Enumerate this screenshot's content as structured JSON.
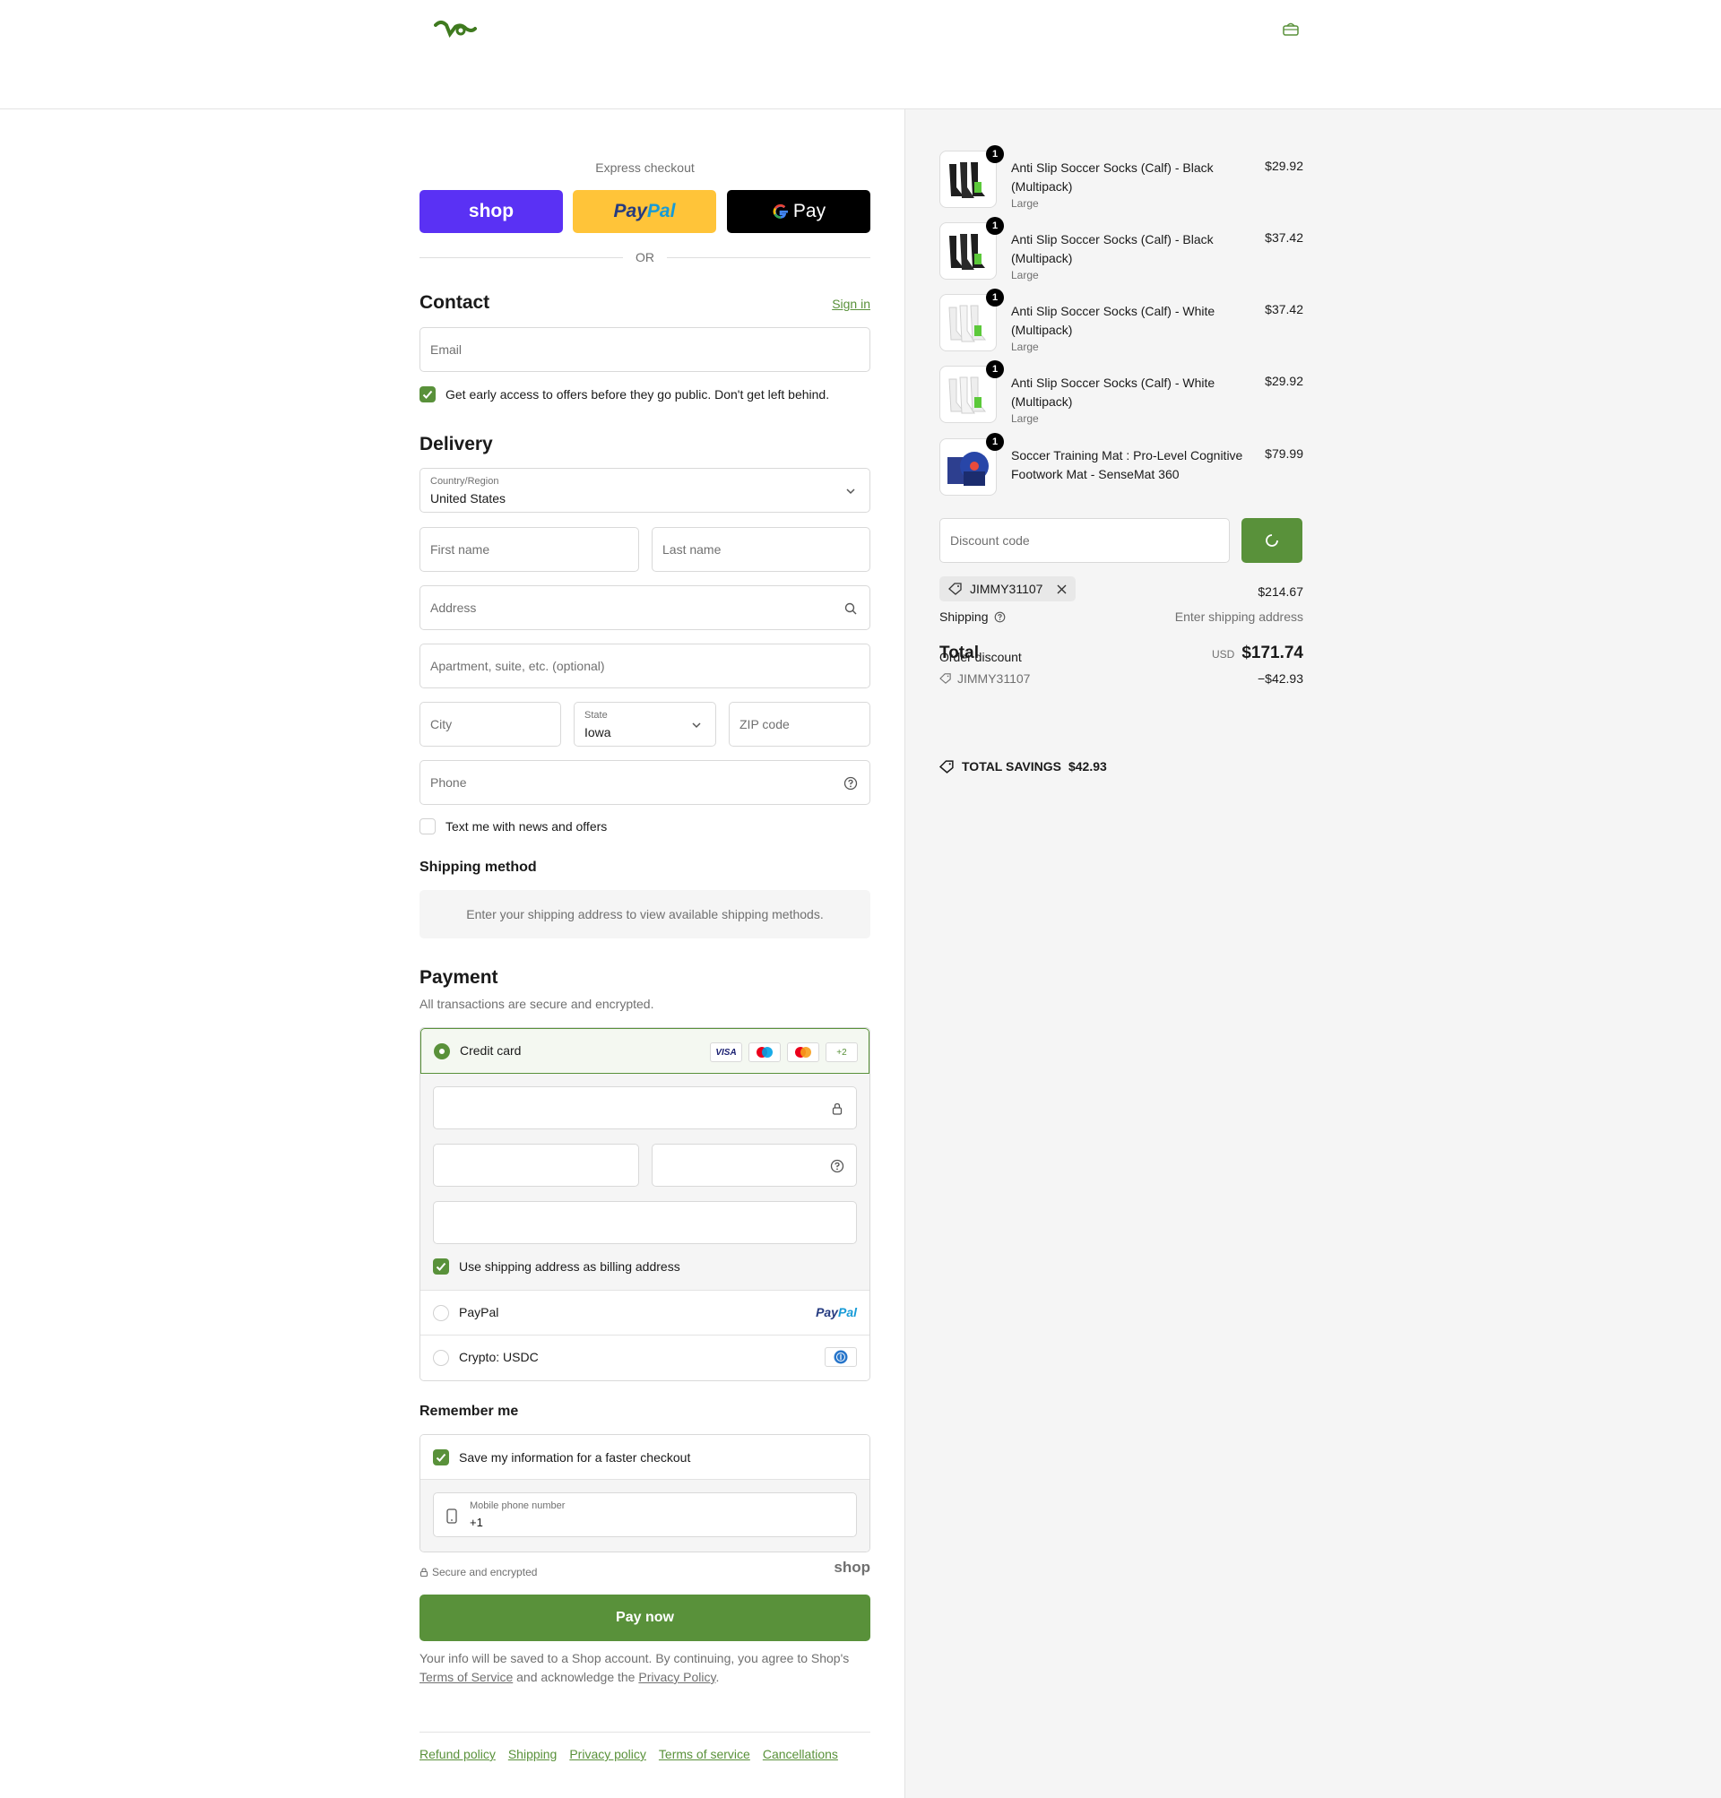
{
  "colors": {
    "accent": "#59913a",
    "shop": "#5a31f4",
    "paypal": "#ffc439",
    "gpay": "#000000"
  },
  "header": {
    "logo_icon": "brand-logo",
    "cart_icon": "bag-icon"
  },
  "express": {
    "title": "Express checkout",
    "shop_label": "shop",
    "paypal_label_1": "Pay",
    "paypal_label_2": "Pal",
    "gpay_label": "Pay",
    "or_label": "OR"
  },
  "contact": {
    "title": "Contact",
    "sign_in": "Sign in",
    "email_placeholder": "Email",
    "offers_label": "Get early access to offers before they go public. Don't get left behind."
  },
  "delivery": {
    "title": "Delivery",
    "country_label": "Country/Region",
    "country_value": "United States",
    "first_name": "First name",
    "last_name": "Last name",
    "address": "Address",
    "apartment": "Apartment, suite, etc. (optional)",
    "city": "City",
    "state_label": "State",
    "state_value": "Iowa",
    "zip": "ZIP code",
    "phone": "Phone",
    "text_me": "Text me with news and offers"
  },
  "shipping_method": {
    "title": "Shipping method",
    "message": "Enter your shipping address to view available shipping methods."
  },
  "payment": {
    "title": "Payment",
    "subtitle": "All transactions are secure and encrypted.",
    "credit_card": "Credit card",
    "card_more": "+2",
    "visa": "VISA",
    "billing_same": "Use shipping address as billing address",
    "paypal": "PayPal",
    "crypto": "Crypto: USDC"
  },
  "remember": {
    "title": "Remember me",
    "save_label": "Save my information for a faster checkout",
    "mobile_label": "Mobile phone number",
    "mobile_value": "+1"
  },
  "secure": {
    "label": "Secure and encrypted",
    "shop": "shop"
  },
  "pay_now": "Pay now",
  "legal": {
    "text_1": "Your info will be saved to a Shop account. By continuing, you agree to Shop's",
    "terms": "Terms of Service",
    "text_2": "and acknowledge the",
    "privacy": "Privacy Policy",
    "text_3": "."
  },
  "footer_links": [
    "Refund policy",
    "Shipping",
    "Privacy policy",
    "Terms of service",
    "Cancellations"
  ],
  "summary": {
    "items": [
      {
        "name": "Anti Slip Soccer Socks (Calf) - Black (Multipack)",
        "variant": "Large",
        "price": "$29.92",
        "qty": "1"
      },
      {
        "name": "Anti Slip Soccer Socks (Calf) - Black (Multipack)",
        "variant": "Large",
        "price": "$37.42",
        "qty": "1"
      },
      {
        "name": "Anti Slip Soccer Socks (Calf) - White (Multipack)",
        "variant": "Large",
        "price": "$37.42",
        "qty": "1"
      },
      {
        "name": "Anti Slip Soccer Socks (Calf) - White (Multipack)",
        "variant": "Large",
        "price": "$29.92",
        "qty": "1"
      },
      {
        "name": "Soccer Training Mat : Pro-Level Cognitive Footwork Mat - SenseMat 360",
        "variant": "",
        "price": "$79.99",
        "qty": "1"
      }
    ],
    "discount_placeholder": "Discount code",
    "applied_code": "JIMMY31107",
    "subtotal": "$214.67",
    "shipping_label": "Shipping",
    "shipping_value": "Enter shipping address",
    "order_discount_label": "Order discount",
    "order_discount_code": "JIMMY31107",
    "order_discount_value": "−$42.93",
    "total_label": "Total",
    "currency": "USD",
    "total_value": "$171.74",
    "savings_label": "TOTAL SAVINGS",
    "savings_value": "$42.93"
  }
}
